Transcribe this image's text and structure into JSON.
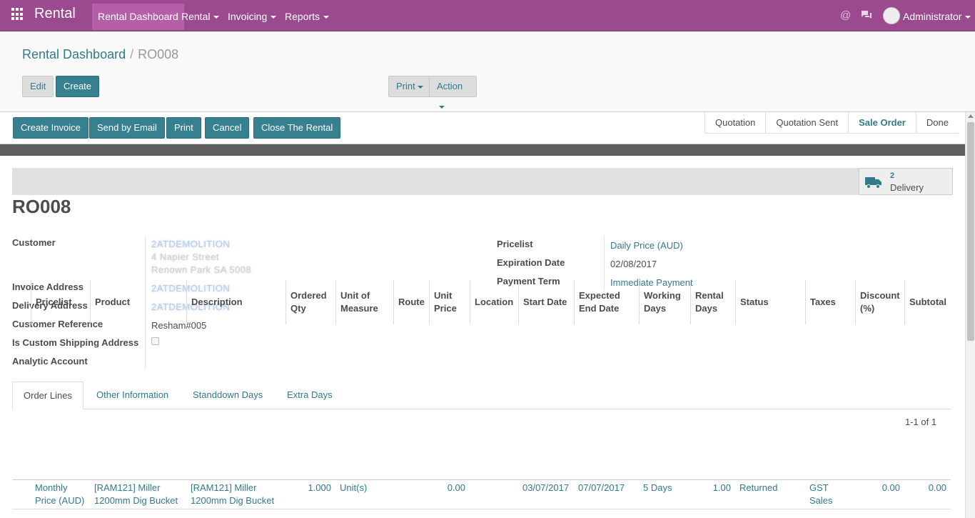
{
  "app": {
    "name": "Rental"
  },
  "nav": {
    "menus": [
      {
        "label": "Rental Dashboard"
      },
      {
        "label": "Rental"
      },
      {
        "label": "Invoicing"
      },
      {
        "label": "Reports"
      }
    ],
    "user": "Administrator"
  },
  "breadcrumb": {
    "parent": "Rental Dashboard",
    "current": "RO008"
  },
  "control": {
    "edit": "Edit",
    "create": "Create",
    "print": "Print",
    "action": "Action"
  },
  "actions": {
    "create_invoice": "Create Invoice",
    "send_email": "Send by Email",
    "print": "Print",
    "cancel": "Cancel",
    "close_rental": "Close The Rental"
  },
  "stages": {
    "s1": "Quotation",
    "s2": "Quotation Sent",
    "s3": "Sale Order",
    "s4": "Done",
    "active": "Sale Order"
  },
  "smart_button": {
    "count": "2",
    "label": "Delivery"
  },
  "record": {
    "name": "RO008",
    "labels": {
      "customer": "Customer",
      "invoice_address": "Invoice Address",
      "delivery_address": "Delivery Address",
      "customer_ref": "Customer Reference",
      "custom_shipping": "Is Custom Shipping Address",
      "analytic": "Analytic Account",
      "pricelist": "Pricelist",
      "expiration": "Expiration Date",
      "payment_term": "Payment Term"
    },
    "values": {
      "customer_name": "2ATDEMOLITION",
      "customer_street": "4 Napier Street",
      "customer_city": "Renown Park SA 5008",
      "invoice_address": "2ATDEMOLITION",
      "delivery_address": "2ATDEMOLITION",
      "customer_ref": "Resham#005",
      "pricelist": "Daily Price (AUD)",
      "expiration": "02/08/2017",
      "payment_term": "Immediate Payment"
    }
  },
  "tabs": {
    "t1": "Order Lines",
    "t2": "Other Information",
    "t3": "Standdown Days",
    "t4": "Extra Days"
  },
  "pager": "1-1 of 1",
  "table": {
    "headers": {
      "pricelist": "Pricelist",
      "product": "Product",
      "description": "Description",
      "ordered_qty_1": "Ordered",
      "ordered_qty_2": "Qty",
      "uom_1": "Unit of",
      "uom_2": "Measure",
      "route": "Route",
      "unit_price_1": "Unit",
      "unit_price_2": "Price",
      "location": "Location",
      "start_date": "Start Date",
      "expected_end_1": "Expected",
      "expected_end_2": "End Date",
      "working_days_1": "Working",
      "working_days_2": "Days",
      "rental_days_1": "Rental",
      "rental_days_2": "Days",
      "status": "Status",
      "taxes": "Taxes",
      "discount_1": "Discount",
      "discount_2": "(%)",
      "subtotal": "Subtotal"
    },
    "row": {
      "pricelist_1": "Monthly",
      "pricelist_2": "Price (AUD)",
      "product_1": "[RAM121] Miller",
      "product_2": "1200mm Dig Bucket",
      "description_1": "[RAM121] Miller",
      "description_2": "1200mm Dig Bucket",
      "ordered_qty": "1.000",
      "uom": "Unit(s)",
      "unit_price": "0.00",
      "start_date": "03/07/2017",
      "expected_end": "07/07/2017",
      "working_days": "5 Days",
      "rental_days": "1.00",
      "status": "Returned",
      "taxes_1": "GST",
      "taxes_2": "Sales",
      "discount": "0.00",
      "subtotal": "0.00"
    }
  },
  "colors": {
    "brand": "#9b4a8f",
    "primary": "#36808f",
    "link": "#337a8a"
  }
}
